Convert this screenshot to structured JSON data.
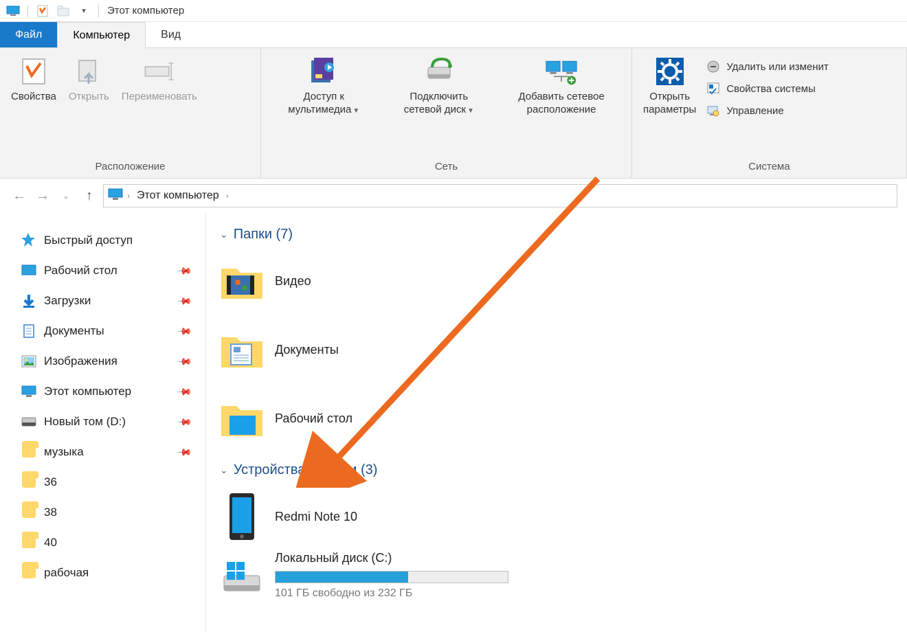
{
  "titlebar": {
    "title": "Этот компьютер"
  },
  "tabs": {
    "file": "Файл",
    "computer": "Компьютер",
    "view": "Вид"
  },
  "ribbon": {
    "location": {
      "properties": "Свойства",
      "open": "Открыть",
      "rename": "Переименовать",
      "group": "Расположение"
    },
    "network": {
      "media": "Доступ к\nмультимедиа",
      "mapdrive": "Подключить\nсетевой диск",
      "addloc": "Добавить сетевое\nрасположение",
      "group": "Сеть"
    },
    "system": {
      "settings": "Открыть\nпараметры",
      "uninstall": "Удалить или изменит",
      "sysprops": "Свойства системы",
      "manage": "Управление",
      "group": "Система"
    }
  },
  "breadcrumb": {
    "root": "Этот компьютер"
  },
  "sidebar": {
    "quick": "Быстрый доступ",
    "items": [
      {
        "label": "Рабочий стол",
        "icon": "desktop",
        "pinned": true
      },
      {
        "label": "Загрузки",
        "icon": "downloads",
        "pinned": true
      },
      {
        "label": "Документы",
        "icon": "documents",
        "pinned": true
      },
      {
        "label": "Изображения",
        "icon": "pictures",
        "pinned": true
      },
      {
        "label": "Этот компьютер",
        "icon": "thispc",
        "pinned": true
      },
      {
        "label": "Новый том (D:)",
        "icon": "drive",
        "pinned": true
      },
      {
        "label": "музыка",
        "icon": "folder",
        "pinned": true
      },
      {
        "label": "36",
        "icon": "folder",
        "pinned": false
      },
      {
        "label": "38",
        "icon": "folder",
        "pinned": false
      },
      {
        "label": "40",
        "icon": "folder",
        "pinned": false
      },
      {
        "label": "рабочая",
        "icon": "folder",
        "pinned": false
      }
    ]
  },
  "content": {
    "folders_head": "Папки (7)",
    "folders": [
      {
        "label": "Видео"
      },
      {
        "label": "Документы"
      },
      {
        "label": "Рабочий стол"
      }
    ],
    "devices_head": "Устройства и диски (3)",
    "devices": {
      "phone": "Redmi Note 10",
      "cdrive_label": "Локальный диск (C:)",
      "cdrive_sub": "101 ГБ свободно из 232 ГБ",
      "cdrive_fill_pct": 57
    }
  }
}
